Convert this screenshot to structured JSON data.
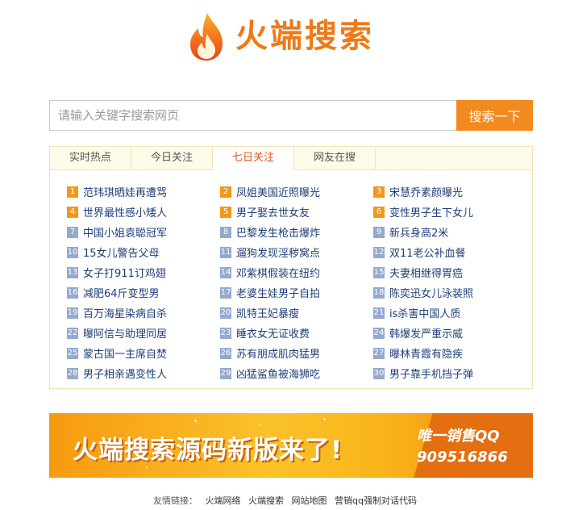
{
  "logo": {
    "text": "火端搜索"
  },
  "search": {
    "placeholder": "请输入关键字搜索网页",
    "button_label": "搜索一下"
  },
  "tabs": [
    {
      "label": "实时热点"
    },
    {
      "label": "今日关注"
    },
    {
      "label": "七日关注"
    },
    {
      "label": "网友在搜"
    }
  ],
  "hot_list": [
    "范玮琪晒娃再遭骂",
    "凤姐美国近照曝光",
    "宋慧乔素颜曝光",
    "世界最性感小矮人",
    "男子娶去世女友",
    "变性男子生下女儿",
    "中国小姐袁聪冠军",
    "巴黎发生枪击爆炸",
    "新兵身高2米",
    "15女儿警告父母",
    "遛狗发现淫秽窝点",
    "双11老公补血餐",
    "女子打911订鸡翅",
    "邓紫棋假装在纽约",
    "夫妻相继得胃癌",
    "减肥64斤变型男",
    "老婆生娃男子自拍",
    "陈奕迅女儿泳装照",
    "百万海星染病自杀",
    "凯特王妃暴瘦",
    "is杀害中国人质",
    "曝阿信与助理同居",
    "睡衣女无证收费",
    "韩爆发严重示威",
    "蒙古国一主席自焚",
    "苏有朋成肌肉猛男",
    "曝林青霞有隐疾",
    "男子相亲遇变性人",
    "凶猛鲨鱼被海狮吃",
    "男子靠手机挡子弹"
  ],
  "banner": {
    "headline": "火端搜索源码新版来了!",
    "sub_line1": "唯一销售QQ",
    "sub_line2": "909516866"
  },
  "footer": {
    "label": "友情链接：",
    "links": [
      "火端网络",
      "火端搜索",
      "网站地图",
      "营销qq强制对话代码"
    ]
  },
  "colors": {
    "brand_orange": "#ef7a16",
    "button_orange": "#f28a1f",
    "link_blue": "#1e3e78",
    "badge_hot": "#f39717",
    "badge_normal": "#93a9d0"
  }
}
